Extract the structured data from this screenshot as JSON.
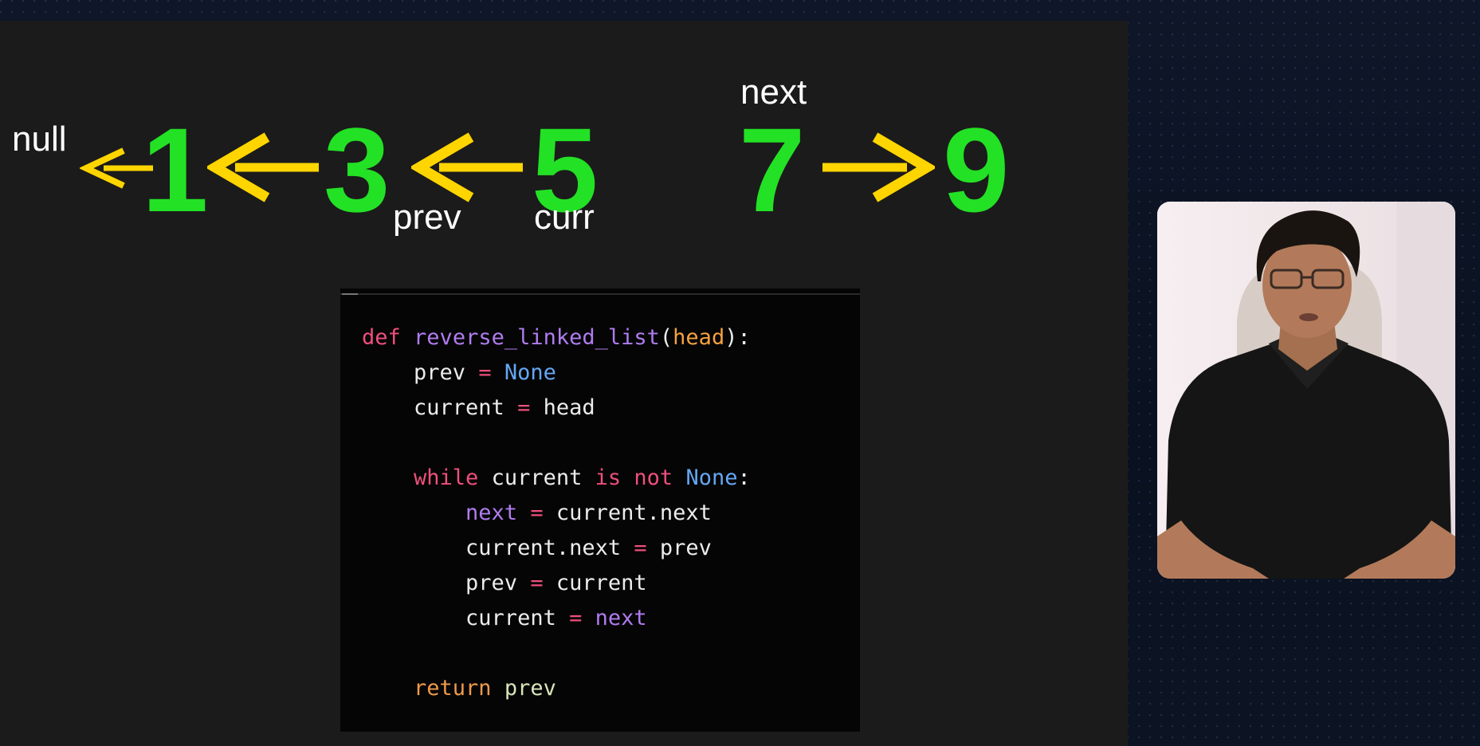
{
  "diagram": {
    "null_label": "null",
    "nodes": [
      "1",
      "3",
      "5",
      "7",
      "9"
    ],
    "pointer_labels": {
      "prev": "prev",
      "curr": "curr",
      "next": "next"
    },
    "colors": {
      "node": "#23e125",
      "arrow": "#ffd500",
      "label": "#ffffff"
    }
  },
  "code": {
    "lines": [
      [
        {
          "t": "def",
          "c": "kw"
        },
        {
          "t": " "
        },
        {
          "t": "reverse_linked_list",
          "c": "fn"
        },
        {
          "t": "("
        },
        {
          "t": "head",
          "c": "arg"
        },
        {
          "t": "):"
        }
      ],
      [
        {
          "t": "    prev "
        },
        {
          "t": "=",
          "c": "op"
        },
        {
          "t": " "
        },
        {
          "t": "None",
          "c": "const"
        }
      ],
      [
        {
          "t": "    current "
        },
        {
          "t": "=",
          "c": "op"
        },
        {
          "t": " head"
        }
      ],
      [],
      [
        {
          "t": "    "
        },
        {
          "t": "while",
          "c": "kw"
        },
        {
          "t": " current "
        },
        {
          "t": "is not",
          "c": "kw"
        },
        {
          "t": " "
        },
        {
          "t": "None",
          "c": "const"
        },
        {
          "t": ":"
        }
      ],
      [
        {
          "t": "        "
        },
        {
          "t": "next",
          "c": "var"
        },
        {
          "t": " "
        },
        {
          "t": "=",
          "c": "op"
        },
        {
          "t": " current.next"
        }
      ],
      [
        {
          "t": "        current.next "
        },
        {
          "t": "=",
          "c": "op"
        },
        {
          "t": " prev"
        }
      ],
      [
        {
          "t": "        prev "
        },
        {
          "t": "=",
          "c": "op"
        },
        {
          "t": " current"
        }
      ],
      [
        {
          "t": "        current "
        },
        {
          "t": "=",
          "c": "op"
        },
        {
          "t": " "
        },
        {
          "t": "next",
          "c": "var"
        }
      ],
      [],
      [
        {
          "t": "    "
        },
        {
          "t": "return",
          "c": "ret"
        },
        {
          "t": " "
        },
        {
          "t": "prev",
          "c": "prev2"
        }
      ]
    ]
  },
  "presenter": {
    "icon": "presenter-webcam",
    "colors": {
      "background": "#efe6e8",
      "shirt": "#151515",
      "skin": "#b27a5a"
    }
  }
}
